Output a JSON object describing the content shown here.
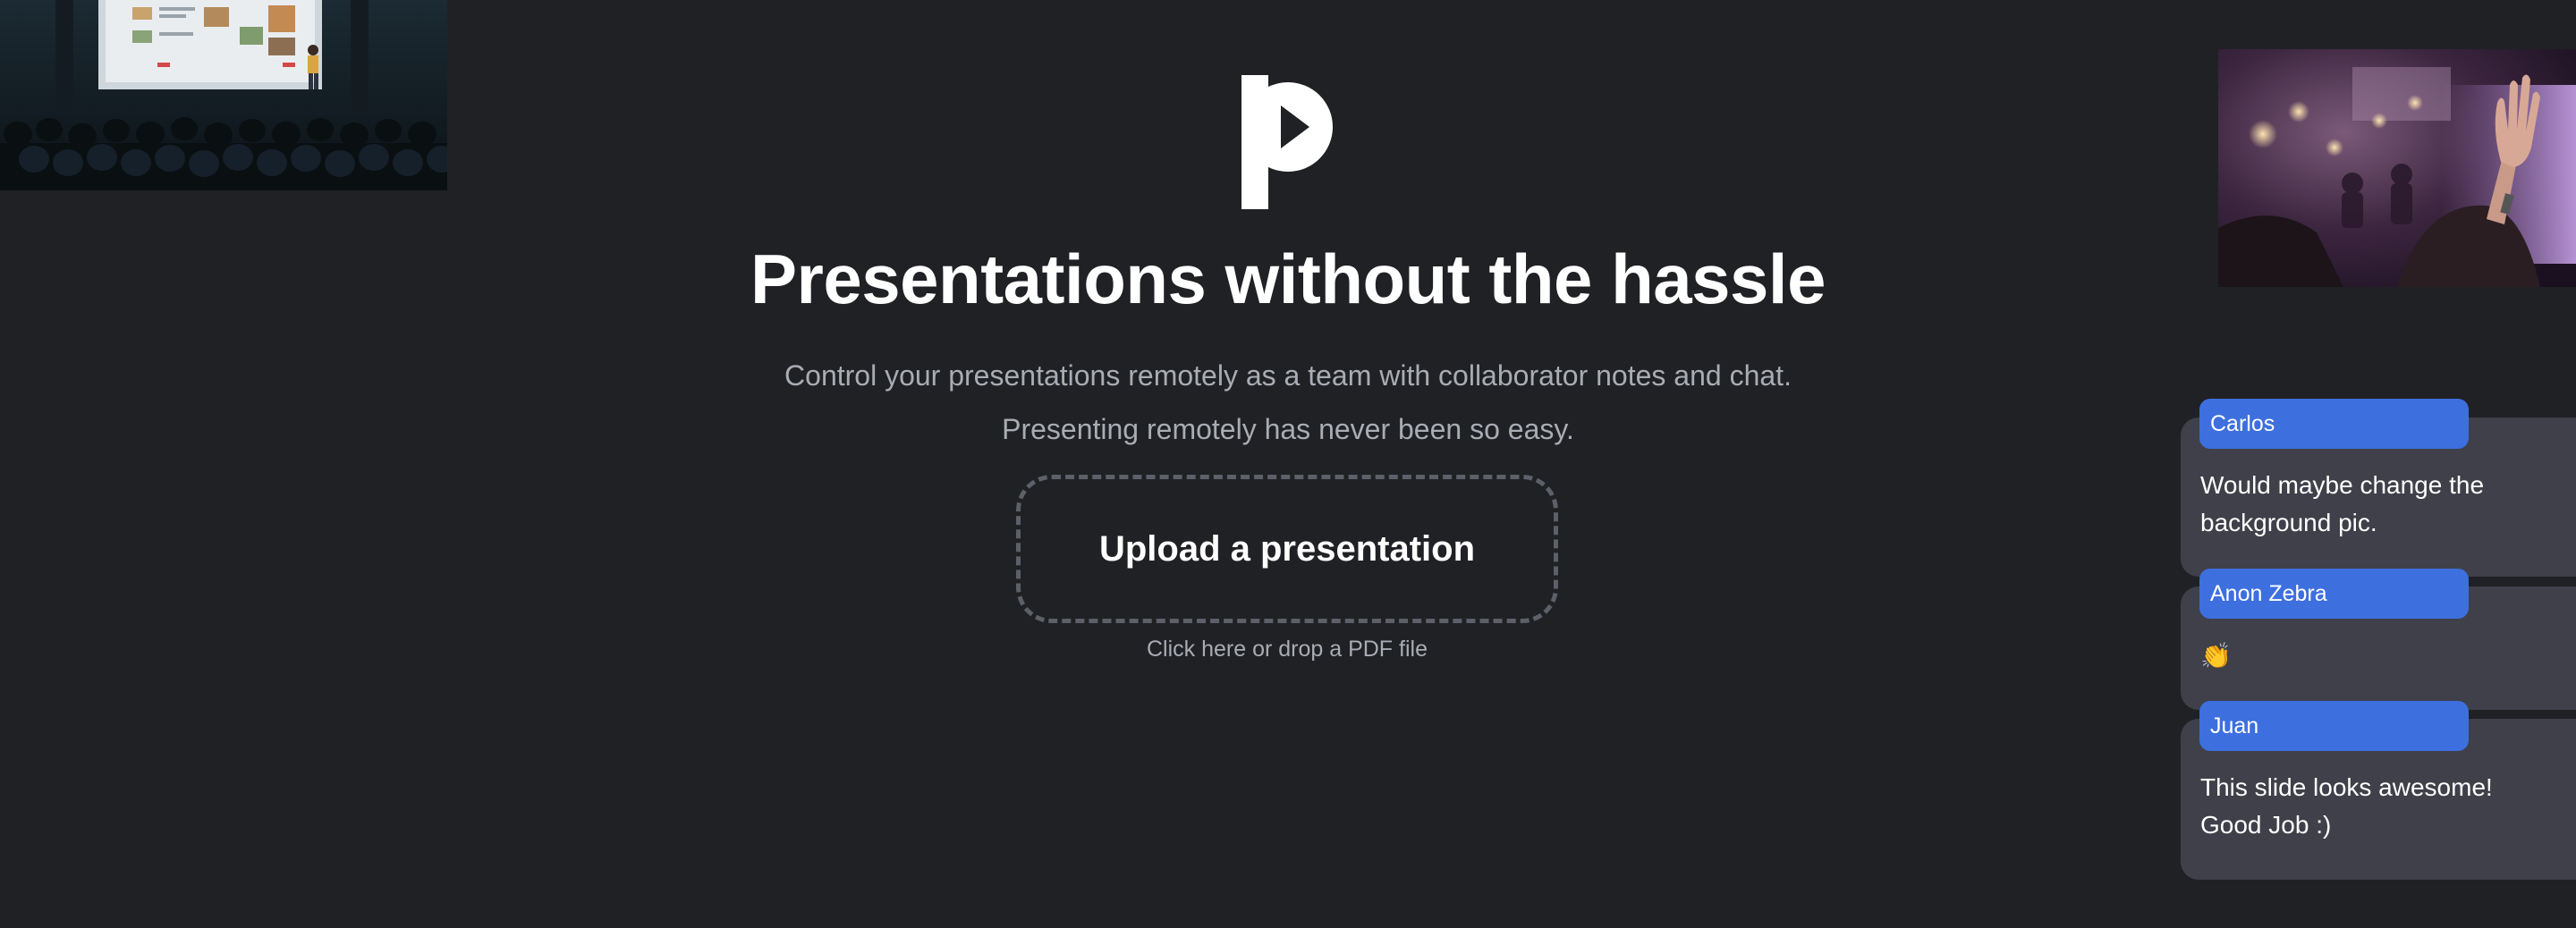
{
  "hero": {
    "headline": "Presentations without the hassle",
    "subtitle_line1": "Control your presentations remotely as a team with collaborator notes and chat.",
    "subtitle_line2": "Presenting remotely has never been so easy.",
    "upload_label": "Upload a presentation",
    "upload_hint": "Click here or drop a PDF file"
  },
  "logo": {
    "icon": "p-play-logo-icon"
  },
  "chat": {
    "messages": [
      {
        "author": "Carlos",
        "text": "Would maybe change the background pic."
      },
      {
        "author": "Anon Zebra",
        "text": "👏"
      },
      {
        "author": "Juan",
        "text": "This slide looks awesome! Good Job :)"
      }
    ]
  },
  "colors": {
    "background": "#202125",
    "accent": "#3d6fdf",
    "card": "#3f4049",
    "muted_text": "#a9acb3",
    "dashed_border": "#5d6069"
  }
}
